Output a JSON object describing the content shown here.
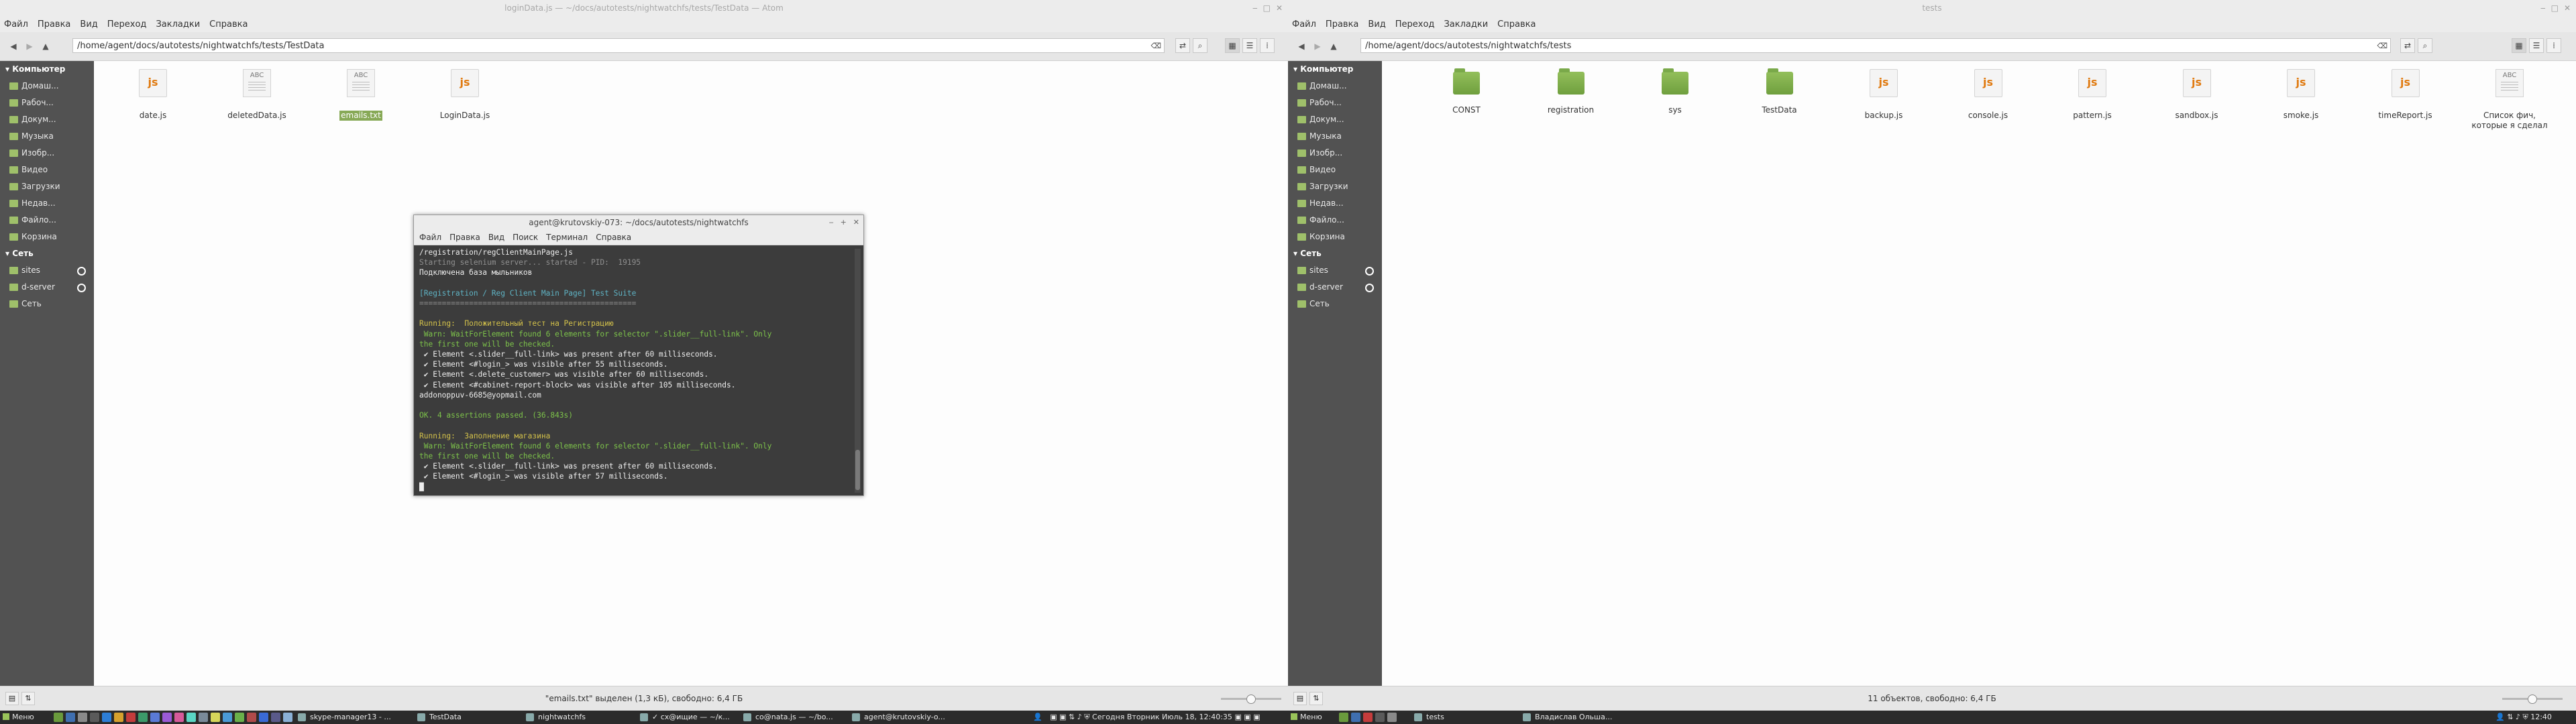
{
  "colors": {
    "accent": "#87a956",
    "sidebar": "#525252",
    "taskbar": "#2b2b2b",
    "folder": "#7aa94a",
    "js": "#e07a10"
  },
  "left_window": {
    "title": "loginData.js — ~/docs/autotests/nightwatchfs/tests/TestData — Atom",
    "menu": [
      "Файл",
      "Правка",
      "Вид",
      "Переход",
      "Закладки",
      "Справка"
    ],
    "path": "/home/agent/docs/autotests/nightwatchfs/tests/TestData",
    "sidebar": {
      "computer_label": "Компьютер",
      "places": [
        "Домаш...",
        "Рабоч...",
        "Докум...",
        "Музыка",
        "Изобр...",
        "Видео",
        "Загрузки",
        "Недав...",
        "Файло...",
        "Корзина"
      ],
      "network_label": "Сеть",
      "network": [
        "sites",
        "d-server",
        "Сеть"
      ]
    },
    "files": [
      {
        "name": "date.js",
        "type": "js",
        "badge": "js"
      },
      {
        "name": "deletedData.js",
        "type": "txt",
        "badge": "ABC"
      },
      {
        "name": "emails.txt",
        "type": "txt",
        "badge": "ABC",
        "selected": true
      },
      {
        "name": "LoginData.js",
        "type": "js",
        "badge": "js"
      }
    ],
    "status": "\"emails.txt\" выделен (1,3 кБ), свободно: 6,4 ГБ"
  },
  "right_window": {
    "title": "tests",
    "menu": [
      "Файл",
      "Правка",
      "Вид",
      "Переход",
      "Закладки",
      "Справка"
    ],
    "path": "/home/agent/docs/autotests/nightwatchfs/tests",
    "sidebar": {
      "computer_label": "Компьютер",
      "places": [
        "Домаш...",
        "Рабоч...",
        "Докум...",
        "Музыка",
        "Изобр...",
        "Видео",
        "Загрузки",
        "Недав...",
        "Файло...",
        "Корзина"
      ],
      "network_label": "Сеть",
      "network": [
        "sites",
        "d-server",
        "Сеть"
      ]
    },
    "files": [
      {
        "name": "CONST",
        "type": "folder",
        "badge": ""
      },
      {
        "name": "registration",
        "type": "folder",
        "badge": ""
      },
      {
        "name": "sys",
        "type": "folder",
        "badge": ""
      },
      {
        "name": "TestData",
        "type": "folder",
        "badge": ""
      },
      {
        "name": "backup.js",
        "type": "js",
        "badge": "js"
      },
      {
        "name": "console.js",
        "type": "js",
        "badge": "js"
      },
      {
        "name": "pattern.js",
        "type": "js",
        "badge": "js"
      },
      {
        "name": "sandbox.js",
        "type": "js",
        "badge": "js"
      },
      {
        "name": "smoke.js",
        "type": "js",
        "badge": "js"
      },
      {
        "name": "timeReport.js",
        "type": "js",
        "badge": "js"
      },
      {
        "name": "Список фич, которые я сделал",
        "type": "txt",
        "badge": "ABC"
      }
    ],
    "status": "11 объектов, свободно: 6,4 ГБ"
  },
  "terminal": {
    "title": "agent@krutovskiy-073: ~/docs/autotests/nightwatchfs",
    "menu": [
      "Файл",
      "Правка",
      "Вид",
      "Поиск",
      "Терминал",
      "Справка"
    ],
    "lines": [
      {
        "text": "/registration/regClientMainPage.js",
        "cls": ""
      },
      {
        "text": "Starting selenium server... started - PID:  19195",
        "cls": "c-grey"
      },
      {
        "text": "Подключена база мыльников",
        "cls": ""
      },
      {
        "text": "",
        "cls": ""
      },
      {
        "text": "[Registration / Reg Client Main Page] Test Suite",
        "cls": "c-cy"
      },
      {
        "text": "================================================",
        "cls": "c-grey"
      },
      {
        "text": "",
        "cls": ""
      },
      {
        "text": "Running:  Положительный тест на Регистрацию",
        "cls": "c-yel"
      },
      {
        "text": " Warn: WaitForElement found 6 elements for selector \".slider__full-link\". Only",
        "cls": "c-green"
      },
      {
        "text": "the first one will be checked.",
        "cls": "c-green"
      },
      {
        "text": " ✔ Element <.slider__full-link> was present after 60 milliseconds.",
        "cls": ""
      },
      {
        "text": " ✔ Element <#login_> was visible after 55 milliseconds.",
        "cls": ""
      },
      {
        "text": " ✔ Element <.delete_customer> was visible after 60 milliseconds.",
        "cls": ""
      },
      {
        "text": " ✔ Element <#cabinet-report-block> was visible after 105 milliseconds.",
        "cls": ""
      },
      {
        "text": "addonoppuv-6685@yopmail.com",
        "cls": ""
      },
      {
        "text": "",
        "cls": ""
      },
      {
        "text": "OK. 4 assertions passed. (36.843s)",
        "cls": "c-green"
      },
      {
        "text": "",
        "cls": ""
      },
      {
        "text": "Running:  Заполнение магазина",
        "cls": "c-yel"
      },
      {
        "text": " Warn: WaitForElement found 6 elements for selector \".slider__full-link\". Only",
        "cls": "c-green"
      },
      {
        "text": "the first one will be checked.",
        "cls": "c-green"
      },
      {
        "text": " ✔ Element <.slider__full-link> was present after 60 milliseconds.",
        "cls": ""
      },
      {
        "text": " ✔ Element <#login_> was visible after 57 milliseconds.",
        "cls": ""
      },
      {
        "text": "█",
        "cls": ""
      }
    ]
  },
  "taskbar": {
    "menu_label": "Меню",
    "windows_left": [
      "skype-manager13 - ...",
      "TestData",
      "nightwatchfs",
      "✓ cx@ищие — ~/к...",
      "co@nata.js — ~/bo...",
      "agent@krutovskiy-o..."
    ],
    "datetime": "Сегодня Вторник Июль 18, 12:40:35",
    "right_menu_label": "Меню",
    "windows_right": [
      "tests",
      "Владислав Ольша..."
    ],
    "clock": "12:40"
  }
}
